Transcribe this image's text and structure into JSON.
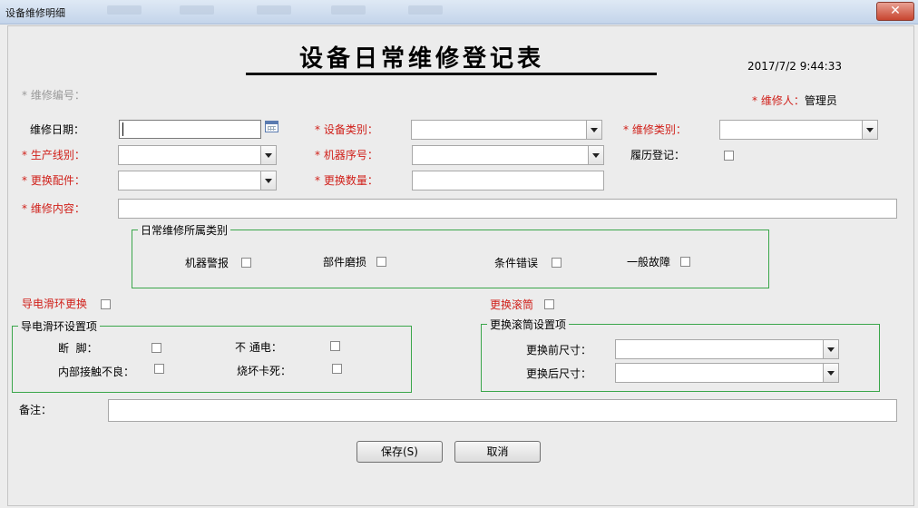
{
  "window": {
    "title": "设备维修明细",
    "close_glyph": "✕"
  },
  "form": {
    "title": "设备日常维修登记表",
    "datetime": "2017/7/2 9:44:33",
    "repair_no_label": "* 维修编号：",
    "repairer_label": "* 维修人：",
    "repairer_value": "管理员",
    "repair_date_label": "维修日期：",
    "equip_type_label": "* 设备类别：",
    "repair_type_label": "* 维修类别：",
    "line_label": "* 生产线别：",
    "machine_no_label": "* 机器序号：",
    "history_label": "履历登记：",
    "part_label": "* 更换配件：",
    "qty_label": "* 更换数量：",
    "content_label": "* 维修内容：",
    "remark_label": "备注："
  },
  "daily_group": {
    "legend": "日常维修所属类别",
    "items": [
      "机器警报",
      "部件磨损",
      "条件错误",
      "一般故障"
    ]
  },
  "slip_ring": {
    "toggle_label": "导电滑环更换",
    "legend": "导电滑环设置项",
    "items": [
      "断  脚：",
      "不 通电：",
      "内部接触不良：",
      "烧坏卡死："
    ]
  },
  "roller": {
    "toggle_label": "更换滚筒",
    "legend": "更换滚筒设置项",
    "before_label": "更换前尺寸：",
    "after_label": "更换后尺寸："
  },
  "buttons": {
    "save": "保存(S)",
    "cancel": "取消"
  },
  "colors": {
    "required": "#d0201a",
    "group_border": "#3aa64a"
  },
  "icons": {
    "calendar": "calendar-icon",
    "dropdown": "chevron-down-icon",
    "close": "close-icon"
  }
}
